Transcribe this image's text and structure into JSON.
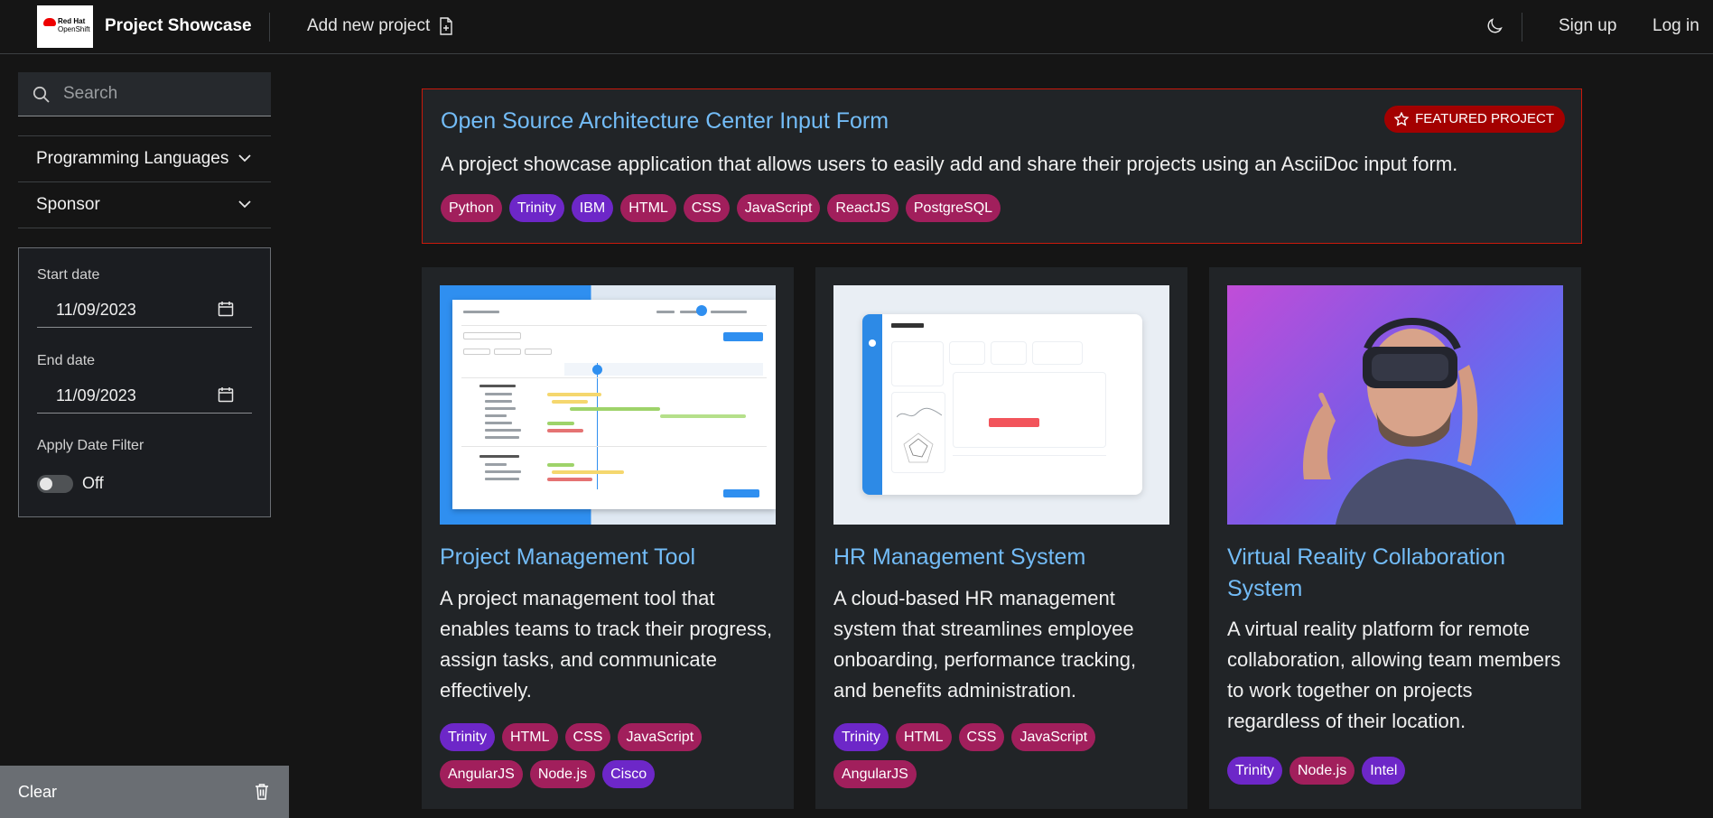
{
  "header": {
    "logo_line1": "Red Hat",
    "logo_line2": "OpenShift",
    "brand": "Project Showcase",
    "add_project": "Add new project",
    "theme_icon": "moon-icon",
    "signup": "Sign up",
    "login": "Log in"
  },
  "sidebar": {
    "search_placeholder": "Search",
    "facets": [
      "Programming Languages",
      "Sponsor"
    ],
    "start_date_label": "Start date",
    "start_date_value": "11/09/2023",
    "end_date_label": "End date",
    "end_date_value": "11/09/2023",
    "apply_filter_label": "Apply Date Filter",
    "toggle_state": "Off",
    "clear_label": "Clear"
  },
  "featured": {
    "title": "Open Source Architecture Center Input Form",
    "badge": "FEATURED PROJECT",
    "description": "A project showcase application that allows users to easily add and share their projects using an AsciiDoc input form.",
    "tags": [
      {
        "label": "Python",
        "color": "#a11f5c"
      },
      {
        "label": "Trinity",
        "color": "#6d27c8"
      },
      {
        "label": "IBM",
        "color": "#6d27c8"
      },
      {
        "label": "HTML",
        "color": "#a11f5c"
      },
      {
        "label": "CSS",
        "color": "#a11f5c"
      },
      {
        "label": "JavaScript",
        "color": "#a11f5c"
      },
      {
        "label": "ReactJS",
        "color": "#a11f5c"
      },
      {
        "label": "PostgreSQL",
        "color": "#a11f5c"
      }
    ]
  },
  "projects": [
    {
      "title": "Project Management Tool",
      "description": "A project management tool that enables teams to track their progress, assign tasks, and communicate effectively.",
      "tags": [
        "Trinity",
        "HTML",
        "CSS",
        "JavaScript",
        "AngularJS",
        "Node.js",
        "Cisco"
      ]
    },
    {
      "title": "HR Management System",
      "description": "A cloud-based HR management system that streamlines employee onboarding, performance tracking, and benefits administration.",
      "tags": [
        "Trinity",
        "HTML",
        "CSS",
        "JavaScript",
        "AngularJS"
      ]
    },
    {
      "title": "Virtual Reality Collaboration System",
      "description": "A virtual reality platform for remote collaboration, allowing team members to work together on projects regardless of their location.",
      "tags": [
        "Trinity",
        "Node.js",
        "Intel"
      ]
    }
  ],
  "colors": {
    "link": "#73bcf7",
    "tag_pink": "#a11f5c",
    "tag_purple": "#6d27c8",
    "featured_border": "#c9190b"
  }
}
